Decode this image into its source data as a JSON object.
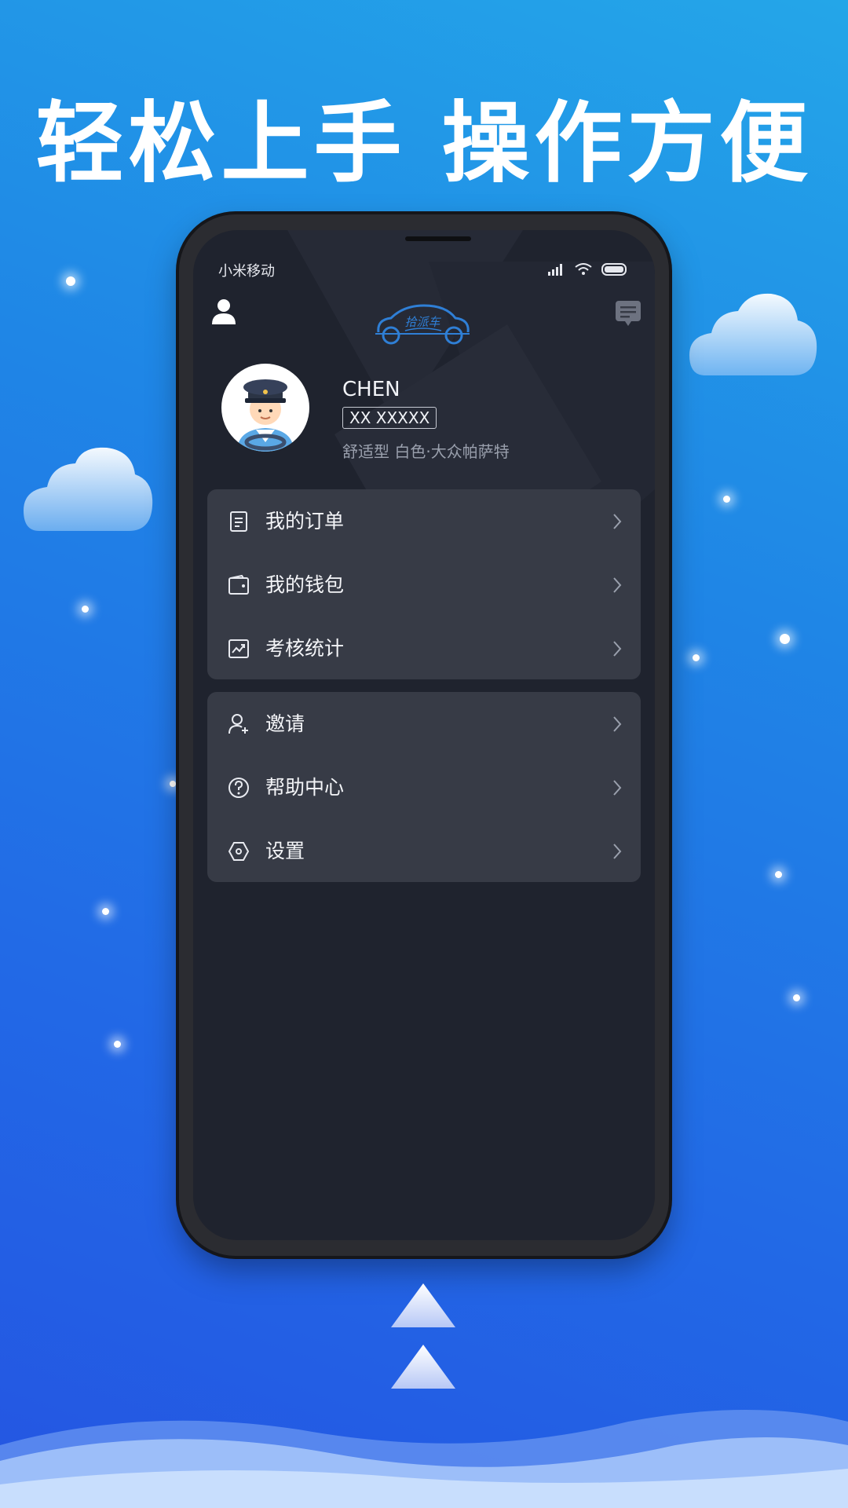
{
  "promo": {
    "headline": "轻松上手 操作方便"
  },
  "status_bar": {
    "carrier": "小米移动"
  },
  "header": {
    "logo_text": "拾派车"
  },
  "profile": {
    "name": "CHEN",
    "plate": "XX XXXXX",
    "car_info": "舒适型 白色·大众帕萨特"
  },
  "menu_group_1": [
    {
      "label": "我的订单",
      "icon": "order-icon"
    },
    {
      "label": "我的钱包",
      "icon": "wallet-icon"
    },
    {
      "label": "考核统计",
      "icon": "stats-icon"
    }
  ],
  "menu_group_2": [
    {
      "label": "邀请",
      "icon": "invite-icon"
    },
    {
      "label": "帮助中心",
      "icon": "help-icon"
    },
    {
      "label": "设置",
      "icon": "settings-icon"
    }
  ],
  "colors": {
    "background_top": "#24a6e8",
    "background_bottom": "#2455e2",
    "screen_bg": "#1f232e",
    "card_bg": "#373b46",
    "logo_blue": "#2f7fd6"
  }
}
